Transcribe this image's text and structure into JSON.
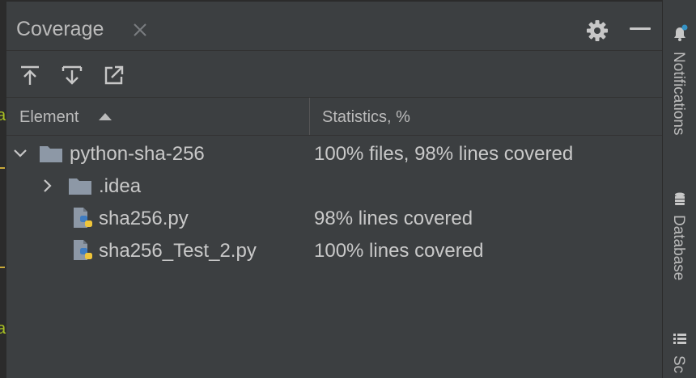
{
  "panel": {
    "title": "Coverage"
  },
  "toolbar": {
    "buttons": [
      {
        "icon": "import-up-icon"
      },
      {
        "icon": "import-down-icon"
      },
      {
        "icon": "export-icon"
      }
    ]
  },
  "table": {
    "columns": [
      "Element",
      "Statistics, %"
    ],
    "sort": "ascending",
    "rows": [
      {
        "name": "python-sha-256",
        "stat": "100% files, 98% lines covered",
        "type": "folder",
        "expanded": true,
        "level": 0
      },
      {
        "name": ".idea",
        "stat": "",
        "type": "folder",
        "expanded": false,
        "level": 1
      },
      {
        "name": "sha256.py",
        "stat": "98% lines covered",
        "type": "python-file",
        "level": 1
      },
      {
        "name": "sha256_Test_2.py",
        "stat": "100% lines covered",
        "type": "python-file",
        "level": 1
      }
    ]
  },
  "right_strip": {
    "items": [
      {
        "label": "Notifications",
        "icon": "bell-icon",
        "has_badge": true
      },
      {
        "label": "Database",
        "icon": "database-icon"
      },
      {
        "label": "Sc",
        "icon": "structure-icon"
      }
    ]
  },
  "colors": {
    "background": "#3c3f41",
    "folder": "#8d98a6",
    "badge": "#3592c4",
    "python_blue": "#3f7cc1",
    "python_yellow": "#f0c53a"
  }
}
